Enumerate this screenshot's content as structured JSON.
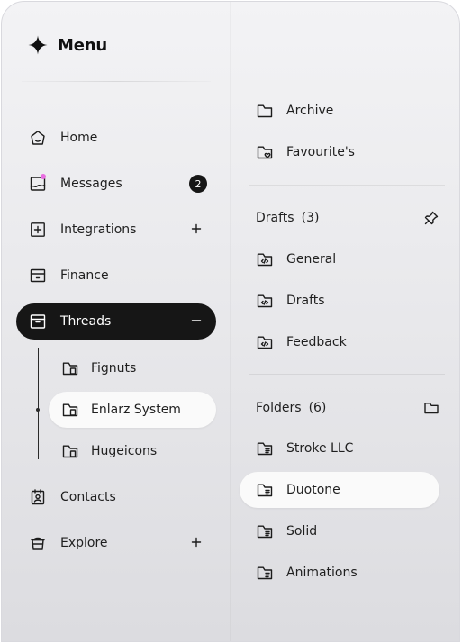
{
  "menu": {
    "title": "Menu",
    "icon": "sparkle-icon"
  },
  "nav": {
    "home": {
      "label": "Home",
      "icon": "home-icon"
    },
    "messages": {
      "label": "Messages",
      "icon": "messages-icon",
      "badge": "2"
    },
    "integrations": {
      "label": "Integrations",
      "icon": "integrations-icon",
      "trail": "plus-icon"
    },
    "finance": {
      "label": "Finance",
      "icon": "finance-icon"
    },
    "threads": {
      "label": "Threads",
      "icon": "threads-icon",
      "trail": "minus-icon",
      "active": true
    },
    "contacts": {
      "label": "Contacts",
      "icon": "contacts-icon"
    },
    "explore": {
      "label": "Explore",
      "icon": "explore-icon",
      "trail": "plus-icon"
    }
  },
  "threads_children": [
    {
      "label": "Fignuts",
      "icon": "folder-file-icon"
    },
    {
      "label": "Enlarz System",
      "icon": "folder-file-icon",
      "selected": true
    },
    {
      "label": "Hugeicons",
      "icon": "folder-file-icon"
    }
  ],
  "right": {
    "top_items": [
      {
        "label": "Archive",
        "icon": "folder-icon"
      },
      {
        "label": "Favourite's",
        "icon": "folder-heart-icon"
      }
    ],
    "drafts": {
      "title": "Drafts",
      "count": "(3)",
      "action_icon": "pin-icon",
      "items": [
        {
          "label": "General",
          "icon": "folder-code-icon"
        },
        {
          "label": "Drafts",
          "icon": "folder-code-icon"
        },
        {
          "label": "Feedback",
          "icon": "folder-code-icon"
        }
      ]
    },
    "folders": {
      "title": "Folders",
      "count": "(6)",
      "action_icon": "folder-icon",
      "items": [
        {
          "label": "Stroke LLC",
          "icon": "folder-details-icon"
        },
        {
          "label": "Duotone",
          "icon": "folder-details-icon",
          "selected": true
        },
        {
          "label": "Solid",
          "icon": "folder-details-icon"
        },
        {
          "label": "Animations",
          "icon": "folder-details-icon"
        }
      ]
    }
  },
  "colors": {
    "active_bg": "#161616",
    "selected_bg": "#fafafa",
    "badge_dot": "#e86ee0"
  }
}
